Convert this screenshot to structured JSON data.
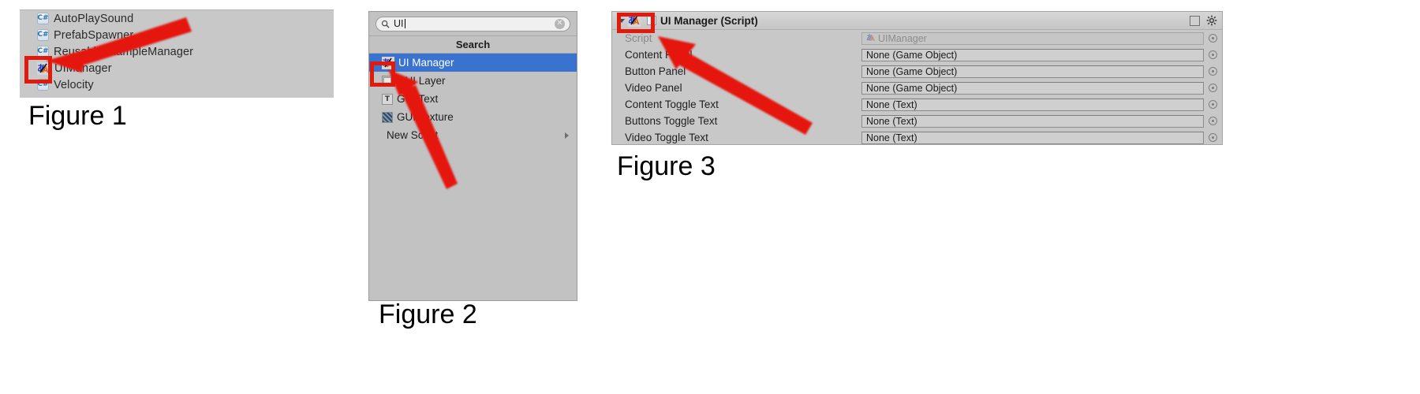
{
  "figure1": {
    "caption": "Figure 1",
    "items": [
      {
        "label": "AutoPlaySound",
        "icon": "csharp-script-icon"
      },
      {
        "label": "PrefabSpawner",
        "icon": "csharp-script-icon"
      },
      {
        "label": "ReusableExampleManager",
        "icon": "csharp-script-icon"
      },
      {
        "label": "UIManager",
        "icon": "ui-manager-script-icon"
      },
      {
        "label": "Velocity",
        "icon": "csharp-script-icon"
      }
    ]
  },
  "figure2": {
    "caption": "Figure 2",
    "search": {
      "value": "UI",
      "placeholder": "Search",
      "search_icon": "magnifier-icon",
      "clear_icon": "clear-circle-icon"
    },
    "header": "Search",
    "items": [
      {
        "label": "UI Manager",
        "icon": "ui-manager-script-icon",
        "selected": true,
        "submenu": false
      },
      {
        "label": "GUI Layer",
        "icon": "gui-layer-icon",
        "selected": false,
        "submenu": false
      },
      {
        "label": "GUI Text",
        "icon": "gui-text-icon",
        "selected": false,
        "submenu": false
      },
      {
        "label": "GUI Texture",
        "icon": "gui-texture-icon",
        "selected": false,
        "submenu": false
      },
      {
        "label": "New Script",
        "icon": "none",
        "selected": false,
        "submenu": true
      }
    ]
  },
  "figure3": {
    "caption": "Figure 3",
    "component_title": "UI Manager (Script)",
    "title_icons": {
      "foldout": "triangle-down-icon",
      "enabled_checkbox": "checkbox-icon",
      "component_icon": "ui-manager-script-icon",
      "help": "book-help-icon",
      "settings": "gear-icon"
    },
    "properties": [
      {
        "label": "Script",
        "value": "UIManager",
        "disabled": true,
        "has_icon": true,
        "picker": "object-picker-icon"
      },
      {
        "label": "Content Panel",
        "value": "None (Game Object)",
        "disabled": false,
        "has_icon": false,
        "picker": "object-picker-icon"
      },
      {
        "label": "Button Panel",
        "value": "None (Game Object)",
        "disabled": false,
        "has_icon": false,
        "picker": "object-picker-icon"
      },
      {
        "label": "Video Panel",
        "value": "None (Game Object)",
        "disabled": false,
        "has_icon": false,
        "picker": "object-picker-icon"
      },
      {
        "label": "Content Toggle Text",
        "value": "None (Text)",
        "disabled": false,
        "has_icon": false,
        "picker": "object-picker-icon"
      },
      {
        "label": "Buttons Toggle Text",
        "value": "None (Text)",
        "disabled": false,
        "has_icon": false,
        "picker": "object-picker-icon"
      },
      {
        "label": "Video Toggle Text",
        "value": "None (Text)",
        "disabled": false,
        "has_icon": false,
        "picker": "object-picker-icon"
      }
    ]
  },
  "annotations": {
    "highlight_color": "#e01b0d",
    "arrow_color": "#e5190b",
    "boxes": [
      {
        "name": "figure1-uimanager-icon-highlight"
      },
      {
        "name": "figure2-uimanager-icon-highlight"
      },
      {
        "name": "figure3-component-icon-highlight"
      }
    ],
    "arrows": [
      {
        "name": "figure1-arrow",
        "points": "from upper-right to UIManager icon"
      },
      {
        "name": "figure2-arrow",
        "points": "from lower-right to UI Manager icon"
      },
      {
        "name": "figure3-arrow",
        "points": "from lower-right to component icon"
      }
    ]
  }
}
